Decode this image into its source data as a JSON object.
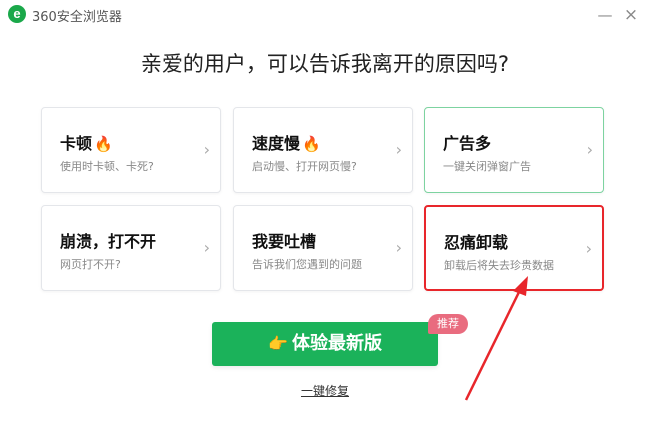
{
  "app": {
    "title": "360安全浏览器",
    "logo_letter": "e"
  },
  "window_controls": {
    "minimize": "—",
    "close": "×"
  },
  "headline": "亲爱的用户，可以告诉我离开的原因吗?",
  "cards": [
    {
      "title": "卡顿",
      "sub": "使用时卡顿、卡死?",
      "fire": "🔥",
      "chevron": "›"
    },
    {
      "title": "速度慢",
      "sub": "启动慢、打开网页慢?",
      "fire": "🔥",
      "chevron": "›"
    },
    {
      "title": "广告多",
      "sub": "一键关闭弹窗广告",
      "chevron": "›"
    },
    {
      "title": "崩溃，打不开",
      "sub": "网页打不开?",
      "chevron": "›"
    },
    {
      "title": "我要吐槽",
      "sub": "告诉我们您遇到的问题",
      "chevron": "›"
    },
    {
      "title": "忍痛卸载",
      "sub": "卸载后将失去珍贵数据",
      "chevron": "›"
    }
  ],
  "cta": {
    "icon": "👉",
    "label": "体验最新版",
    "badge": "推荐"
  },
  "link": {
    "label": "一键修复"
  },
  "colors": {
    "brand_green": "#1bb25a",
    "highlight_red": "#e8262b",
    "badge_pink": "#e96c7f"
  }
}
